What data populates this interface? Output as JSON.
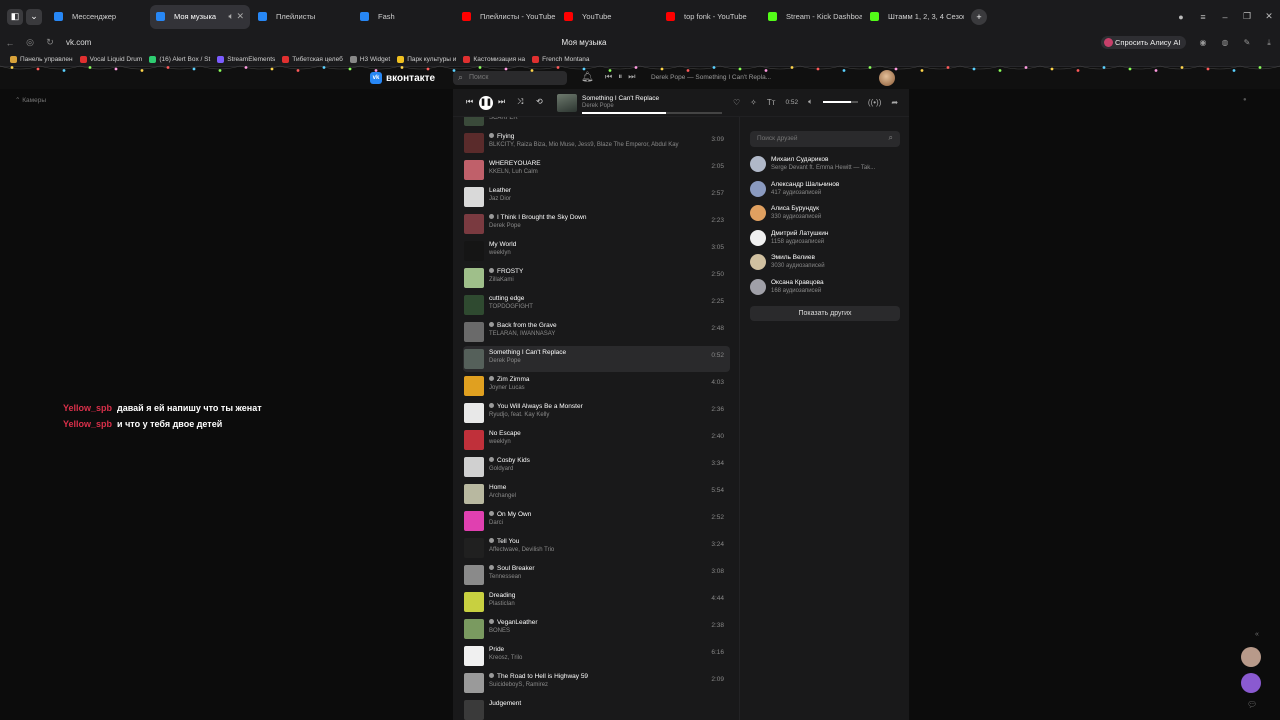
{
  "tabs": [
    {
      "label": "Мессенджер",
      "color": "#2787f5",
      "active": false
    },
    {
      "label": "Моя музыка",
      "color": "#2787f5",
      "active": true
    },
    {
      "label": "Плейлисты",
      "color": "#2787f5",
      "active": false
    },
    {
      "label": "Fash",
      "color": "#2787f5",
      "active": false
    },
    {
      "label": "Плейлисты - YouTube",
      "color": "#ff0000",
      "active": false
    },
    {
      "label": "YouTube",
      "color": "#ff0000",
      "active": false
    },
    {
      "label": "top fonk - YouTube",
      "color": "#ff0000",
      "active": false
    },
    {
      "label": "Stream - Kick Dashboard",
      "color": "#53fc18",
      "active": false
    },
    {
      "label": "Штамм 1, 2, 3, 4 Сезон См",
      "color": "#53fc18",
      "active": false
    }
  ],
  "address": {
    "url": "vk.com",
    "page_title": "Моя музыка",
    "alisa_label": "Спросить Алису AI"
  },
  "bookmarks": [
    {
      "label": "Панель управлен",
      "color": "#d8a23a"
    },
    {
      "label": "Vocal Liquid Drum",
      "color": "#e03030"
    },
    {
      "label": "(16) Alert Box / St",
      "color": "#2ecc71"
    },
    {
      "label": "StreamElements",
      "color": "#7b5cff"
    },
    {
      "label": "Тибетская целеб",
      "color": "#e03030"
    },
    {
      "label": "H3 Widget",
      "color": "#888888"
    },
    {
      "label": "Парк культуры и",
      "color": "#f0c020"
    },
    {
      "label": "Кастомизация на",
      "color": "#e03030"
    },
    {
      "label": "French Montana",
      "color": "#e03030"
    }
  ],
  "vk": {
    "logo": "вконтакте",
    "search_placeholder": "Поиск",
    "now_mini": "Derek Pope — Something I Can't Repla..."
  },
  "left": {
    "cams_label": "Камеры"
  },
  "chat": [
    {
      "user": "Yellow_spb",
      "text": "давай я ей напишу что ты женат"
    },
    {
      "user": "Yellow_spb",
      "text": "и что у тебя двое детей"
    }
  ],
  "player": {
    "title": "Something I Can't Replace",
    "artist": "Derek Pope",
    "time": "0:52",
    "progress": 0.6,
    "volume": 0.8
  },
  "tracks": [
    {
      "title": "Cigarette Sounds Full",
      "artist": "SCARFER",
      "duration": "2:27",
      "explicit": true,
      "cover": "#3a4a3a"
    },
    {
      "title": "Flying",
      "artist": "BLKCITY, Raiza Biza, Mio Muse, Jess9, Blaze The Emperor, Abdul Kay",
      "duration": "3:09",
      "explicit": true,
      "cover": "#5a2b2b"
    },
    {
      "title": "WHEREYOUARE",
      "artist": "KKELN, Luh Calm",
      "duration": "2:05",
      "explicit": false,
      "cover": "#c0606a"
    },
    {
      "title": "Leather",
      "artist": "Jaz Dior",
      "duration": "2:57",
      "explicit": false,
      "cover": "#d9d9d9"
    },
    {
      "title": "I Think I Brought the Sky Down",
      "artist": "Derek Pope",
      "duration": "2:23",
      "explicit": true,
      "cover": "#7a3a40"
    },
    {
      "title": "My World",
      "artist": "weeklyn",
      "duration": "3:05",
      "explicit": false,
      "cover": "#151515"
    },
    {
      "title": "FROSTY",
      "artist": "ZillaKami",
      "duration": "2:50",
      "explicit": true,
      "cover": "#9fbf8a"
    },
    {
      "title": "cutting edge",
      "artist": "TOPDOGFIGHT",
      "duration": "2:25",
      "explicit": false,
      "cover": "#2f4a30"
    },
    {
      "title": "Back from the Grave",
      "artist": "TELARAN, IWANNASAY",
      "duration": "2:48",
      "explicit": true,
      "cover": "#6a6a6a"
    },
    {
      "title": "Something I Can't Replace",
      "artist": "Derek Pope",
      "duration": "0:52",
      "explicit": false,
      "cover": "#55605a"
    },
    {
      "title": "Zim Zimma",
      "artist": "Joyner Lucas",
      "duration": "4:03",
      "explicit": true,
      "cover": "#e0a020"
    },
    {
      "title": "You Will Always Be a Monster",
      "artist": "Ryudjo, feat. Kay Kelly",
      "duration": "2:36",
      "explicit": true,
      "cover": "#e8e8e8"
    },
    {
      "title": "No Escape",
      "artist": "weeklyn",
      "duration": "2:40",
      "explicit": false,
      "cover": "#c0303a"
    },
    {
      "title": "Cosby Kids",
      "artist": "Goldyard",
      "duration": "3:34",
      "explicit": true,
      "cover": "#d0d0d0"
    },
    {
      "title": "Home",
      "artist": "Archangel",
      "duration": "5:54",
      "explicit": false,
      "cover": "#b8b8a0"
    },
    {
      "title": "On My Own",
      "artist": "Darci",
      "duration": "2:52",
      "explicit": true,
      "cover": "#e040b0"
    },
    {
      "title": "Tell You",
      "artist": "Affectwave, Devilish Trio",
      "duration": "3:24",
      "explicit": true,
      "cover": "#202020"
    },
    {
      "title": "Soul Breaker",
      "artist": "Tennessean",
      "duration": "3:08",
      "explicit": true,
      "cover": "#8a8a8a"
    },
    {
      "title": "Dreading",
      "artist": "Plasticlan",
      "duration": "4:44",
      "explicit": false,
      "cover": "#c8d040"
    },
    {
      "title": "VeganLeather",
      "artist": "BONES",
      "duration": "2:38",
      "explicit": true,
      "cover": "#7a9a60"
    },
    {
      "title": "Pride",
      "artist": "Kreosz, Trilo",
      "duration": "6:16",
      "explicit": false,
      "cover": "#f0f0f0"
    },
    {
      "title": "The Road to Hell is Highway 59",
      "artist": "SuicideboyS, Ramirez",
      "duration": "2:09",
      "explicit": true,
      "cover": "#9a9a9a"
    },
    {
      "title": "Judgement",
      "artist": "",
      "duration": "",
      "explicit": false,
      "cover": "#3a3a3a"
    }
  ],
  "friends": {
    "search_placeholder": "Поиск друзей",
    "items": [
      {
        "name": "Михаил Судариков",
        "sub": "Serge Devant ft. Emma Hewitt — Tak...",
        "color": "#b0b8c8"
      },
      {
        "name": "Александр Шальчинов",
        "sub": "417 аудиозаписей",
        "color": "#8a9ac0"
      },
      {
        "name": "Алиса Бурундук",
        "sub": "330 аудиозаписей",
        "color": "#e0a060"
      },
      {
        "name": "Дмитрий Латушкин",
        "sub": "1158 аудиозаписей",
        "color": "#f0f0f0"
      },
      {
        "name": "Эмиль Велиев",
        "sub": "3030 аудиозаписей",
        "color": "#d0c0a0"
      },
      {
        "name": "Оксана Кравцова",
        "sub": "168 аудиозаписей",
        "color": "#a0a0a8"
      }
    ],
    "show_more": "Показать других"
  },
  "right_avatars": [
    {
      "color": "#b89a8a"
    },
    {
      "color": "#8a5ad0"
    }
  ]
}
